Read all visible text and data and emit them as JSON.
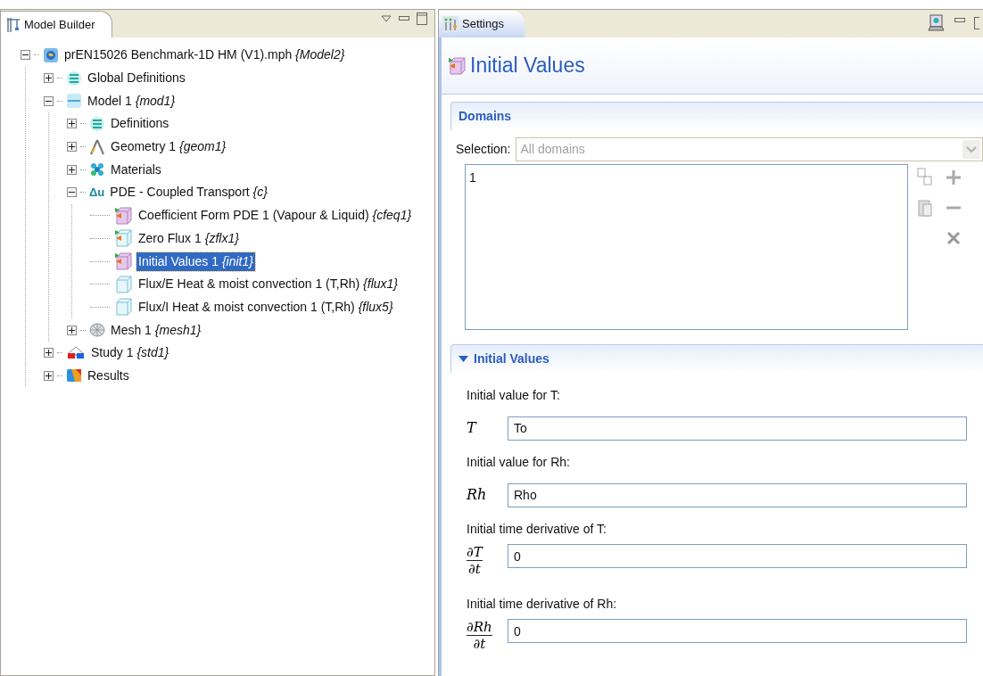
{
  "model_builder": {
    "tab_title": "Model Builder",
    "tree": [
      {
        "label": "prEN15026 Benchmark-1D HM (V1).mph",
        "tag": "{Model2}",
        "kind": "model",
        "expanded": true,
        "selected": false,
        "children": [
          {
            "label": "Global Definitions",
            "kind": "definitions",
            "expanded": false,
            "selected": false
          },
          {
            "label": "Model 1",
            "tag": "{mod1}",
            "kind": "component",
            "expanded": true,
            "selected": false,
            "children": [
              {
                "label": "Definitions",
                "kind": "definitions",
                "expanded": false,
                "selected": false
              },
              {
                "label": "Geometry 1",
                "tag": "{geom1}",
                "kind": "geometry",
                "expanded": false,
                "selected": false
              },
              {
                "label": "Materials",
                "kind": "materials",
                "expanded": false,
                "selected": false
              },
              {
                "label": "PDE - Coupled Transport",
                "tag": "{c}",
                "kind": "pde",
                "icon_text": "Δu",
                "expanded": true,
                "selected": false,
                "children": [
                  {
                    "label": "Coefficient Form PDE 1 (Vapour & Liquid)",
                    "tag": "{cfeq1}",
                    "kind": "domain",
                    "selected": false
                  },
                  {
                    "label": "Zero Flux 1",
                    "tag": "{zflx1}",
                    "kind": "boundary-default",
                    "selected": false
                  },
                  {
                    "label": "Initial Values 1",
                    "tag": "{init1}",
                    "kind": "domain",
                    "selected": true
                  },
                  {
                    "label": "Flux/E Heat & moist convection 1 (T,Rh)",
                    "tag": "{flux1}",
                    "kind": "boundary",
                    "selected": false
                  },
                  {
                    "label": "Flux/I Heat & moist convection 1 (T,Rh)",
                    "tag": "{flux5}",
                    "kind": "boundary",
                    "selected": false
                  }
                ]
              },
              {
                "label": "Mesh 1",
                "tag": "{mesh1}",
                "kind": "mesh",
                "expanded": false,
                "selected": false
              }
            ]
          },
          {
            "label": "Study 1",
            "tag": "{std1}",
            "kind": "study",
            "expanded": false,
            "selected": false
          },
          {
            "label": "Results",
            "kind": "results",
            "expanded": false,
            "selected": false
          }
        ]
      }
    ]
  },
  "settings": {
    "tab_title": "Settings",
    "title": "Initial Values",
    "domains": {
      "header": "Domains",
      "selection_label": "Selection:",
      "selection_value": "All domains",
      "selection_disabled": true,
      "list_items": [
        "1"
      ]
    },
    "initial_values": {
      "header": "Initial Values",
      "expanded": true,
      "fields": [
        {
          "description": "Initial value for T:",
          "kind": "symbol",
          "symbol": "T",
          "value": "To"
        },
        {
          "description": "Initial value for Rh:",
          "kind": "symbol",
          "symbol": "Rh",
          "value": "Rho"
        },
        {
          "description": "Initial time derivative of T:",
          "kind": "fraction",
          "numerator": "∂T",
          "denominator": "∂t",
          "value": "0"
        },
        {
          "description": "Initial time derivative of Rh:",
          "kind": "fraction",
          "numerator": "∂Rh",
          "denominator": "∂t",
          "value": "0"
        }
      ]
    }
  }
}
